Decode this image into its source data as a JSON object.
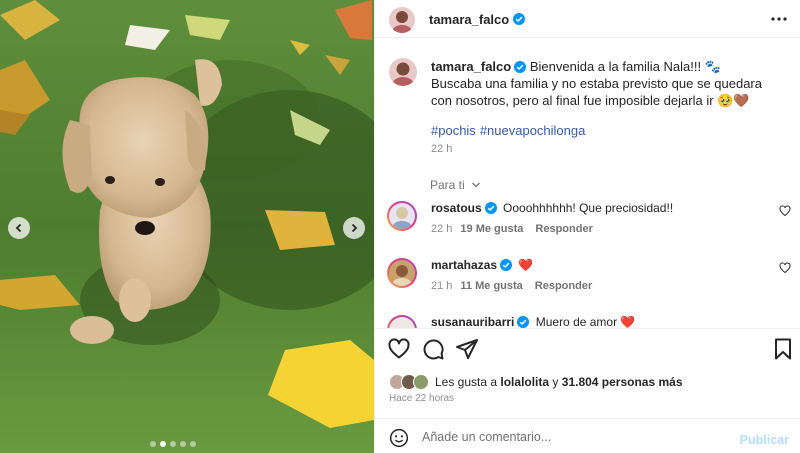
{
  "post": {
    "author": "tamara_falco",
    "caption_line1": "Bienvenida a la familia Nala!!! 🐾",
    "caption_rest": "Buscaba una familia y no estaba previsto que se quedara con nosotros, pero al final fue imposible dejarla ir 🥹🤎",
    "hashtags": [
      "#pochis",
      "#nuevapochilonga"
    ],
    "caption_time": "22 h",
    "sort_label": "Para ti"
  },
  "comments": [
    {
      "user": "rosatous",
      "text": "Oooohhhhhh! Que preciosidad!!",
      "time": "22 h",
      "likes": "19 Me gusta",
      "reply": "Responder",
      "verified": true
    },
    {
      "user": "martahazas",
      "text": "❤️",
      "time": "21 h",
      "likes": "11 Me gusta",
      "reply": "Responder",
      "verified": true
    },
    {
      "user": "susanauribarri",
      "text": "Muero de amor ❤️",
      "time": "",
      "likes": "",
      "reply": "",
      "verified": true
    }
  ],
  "likes": {
    "prefix": "Les gusta a",
    "user": "lolalolita",
    "connector": "y",
    "count": "31.804 personas más"
  },
  "post_time": "Hace 22 horas",
  "add_comment": {
    "placeholder": "Añade un comentario...",
    "publish_label": "Publicar"
  },
  "colors": {
    "verified": "#0095f6",
    "hashtag": "#3a5aa8",
    "publish_disabled": "#b2dffc",
    "heart_red": "#ed4956"
  },
  "carousel": {
    "slides": 5,
    "active": 1
  }
}
